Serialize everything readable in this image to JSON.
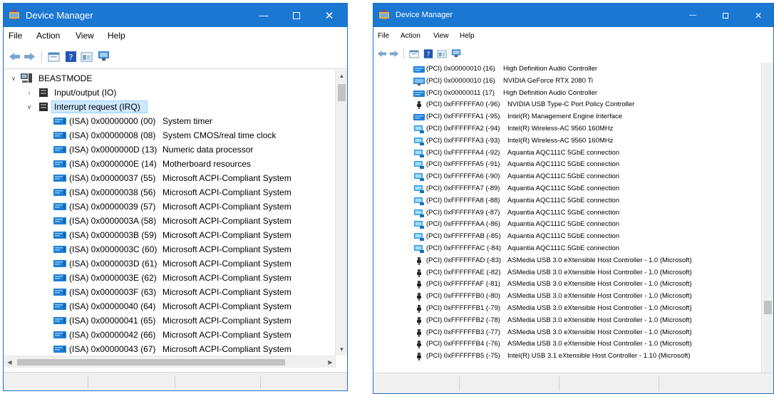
{
  "windows": [
    {
      "title": "Device Manager",
      "menu": [
        "File",
        "Action",
        "View",
        "Help"
      ],
      "tree": {
        "root": "BEASTMODE",
        "categories": [
          {
            "label": "Input/output (IO)",
            "expanded": false
          },
          {
            "label": "Interrupt request (IRQ)",
            "expanded": true
          }
        ],
        "irq_entries": [
          {
            "code": "(ISA) 0x00000000 (00)",
            "desc": "System timer"
          },
          {
            "code": "(ISA) 0x00000008 (08)",
            "desc": "System CMOS/real time clock"
          },
          {
            "code": "(ISA) 0x0000000D (13)",
            "desc": "Numeric data processor"
          },
          {
            "code": "(ISA) 0x0000000E (14)",
            "desc": "Motherboard resources"
          },
          {
            "code": "(ISA) 0x00000037 (55)",
            "desc": "Microsoft ACPI-Compliant System"
          },
          {
            "code": "(ISA) 0x00000038 (56)",
            "desc": "Microsoft ACPI-Compliant System"
          },
          {
            "code": "(ISA) 0x00000039 (57)",
            "desc": "Microsoft ACPI-Compliant System"
          },
          {
            "code": "(ISA) 0x0000003A (58)",
            "desc": "Microsoft ACPI-Compliant System"
          },
          {
            "code": "(ISA) 0x0000003B (59)",
            "desc": "Microsoft ACPI-Compliant System"
          },
          {
            "code": "(ISA) 0x0000003C (60)",
            "desc": "Microsoft ACPI-Compliant System"
          },
          {
            "code": "(ISA) 0x0000003D (61)",
            "desc": "Microsoft ACPI-Compliant System"
          },
          {
            "code": "(ISA) 0x0000003E (62)",
            "desc": "Microsoft ACPI-Compliant System"
          },
          {
            "code": "(ISA) 0x0000003F (63)",
            "desc": "Microsoft ACPI-Compliant System"
          },
          {
            "code": "(ISA) 0x00000040 (64)",
            "desc": "Microsoft ACPI-Compliant System"
          },
          {
            "code": "(ISA) 0x00000041 (65)",
            "desc": "Microsoft ACPI-Compliant System"
          },
          {
            "code": "(ISA) 0x00000042 (66)",
            "desc": "Microsoft ACPI-Compliant System"
          },
          {
            "code": "(ISA) 0x00000043 (67)",
            "desc": "Microsoft ACPI-Compliant System"
          }
        ]
      }
    },
    {
      "title": "Device Manager",
      "menu": [
        "File",
        "Action",
        "View",
        "Help"
      ],
      "pci_entries": [
        {
          "code": "(PCI) 0x00000010 (16)",
          "desc": "High Definition Audio Controller",
          "icon": "audio-device-icon"
        },
        {
          "code": "(PCI) 0x00000010 (16)",
          "desc": "NVIDIA GeForce RTX 2080 Ti",
          "icon": "display-adapter-icon"
        },
        {
          "code": "(PCI) 0x00000011 (17)",
          "desc": "High Definition Audio Controller",
          "icon": "audio-device-icon"
        },
        {
          "code": "(PCI) 0xFFFFFFA0 (-96)",
          "desc": "NVIDIA USB Type-C Port Policy Controller",
          "icon": "usb-plug-icon"
        },
        {
          "code": "(PCI) 0xFFFFFFA1 (-95)",
          "desc": "Intel(R) Management Engine Interface",
          "icon": "system-device-icon"
        },
        {
          "code": "(PCI) 0xFFFFFFA2 (-94)",
          "desc": "Intel(R) Wireless-AC 9560 160MHz",
          "icon": "network-adapter-icon"
        },
        {
          "code": "(PCI) 0xFFFFFFA3 (-93)",
          "desc": "Intel(R) Wireless-AC 9560 160MHz",
          "icon": "network-adapter-icon"
        },
        {
          "code": "(PCI) 0xFFFFFFA4 (-92)",
          "desc": "Aquantia AQC111C 5GbE connection",
          "icon": "network-adapter-icon"
        },
        {
          "code": "(PCI) 0xFFFFFFA5 (-91)",
          "desc": "Aquantia AQC111C 5GbE connection",
          "icon": "network-adapter-icon"
        },
        {
          "code": "(PCI) 0xFFFFFFA6 (-90)",
          "desc": "Aquantia AQC111C 5GbE connection",
          "icon": "network-adapter-icon"
        },
        {
          "code": "(PCI) 0xFFFFFFA7 (-89)",
          "desc": "Aquantia AQC111C 5GbE connection",
          "icon": "network-adapter-icon"
        },
        {
          "code": "(PCI) 0xFFFFFFA8 (-88)",
          "desc": "Aquantia AQC111C 5GbE connection",
          "icon": "network-adapter-icon"
        },
        {
          "code": "(PCI) 0xFFFFFFA9 (-87)",
          "desc": "Aquantia AQC111C 5GbE connection",
          "icon": "network-adapter-icon"
        },
        {
          "code": "(PCI) 0xFFFFFFAA (-86)",
          "desc": "Aquantia AQC111C 5GbE connection",
          "icon": "network-adapter-icon"
        },
        {
          "code": "(PCI) 0xFFFFFFAB (-85)",
          "desc": "Aquantia AQC111C 5GbE connection",
          "icon": "network-adapter-icon"
        },
        {
          "code": "(PCI) 0xFFFFFFAC (-84)",
          "desc": "Aquantia AQC111C 5GbE connection",
          "icon": "network-adapter-icon"
        },
        {
          "code": "(PCI) 0xFFFFFFAD (-83)",
          "desc": "ASMedia USB 3.0 eXtensible Host Controller - 1.0 (Microsoft)",
          "icon": "usb-plug-icon"
        },
        {
          "code": "(PCI) 0xFFFFFFAE (-82)",
          "desc": "ASMedia USB 3.0 eXtensible Host Controller - 1.0 (Microsoft)",
          "icon": "usb-plug-icon"
        },
        {
          "code": "(PCI) 0xFFFFFFAF (-81)",
          "desc": "ASMedia USB 3.0 eXtensible Host Controller - 1.0 (Microsoft)",
          "icon": "usb-plug-icon"
        },
        {
          "code": "(PCI) 0xFFFFFFB0 (-80)",
          "desc": "ASMedia USB 3.0 eXtensible Host Controller - 1.0 (Microsoft)",
          "icon": "usb-plug-icon"
        },
        {
          "code": "(PCI) 0xFFFFFFB1 (-79)",
          "desc": "ASMedia USB 3.0 eXtensible Host Controller - 1.0 (Microsoft)",
          "icon": "usb-plug-icon"
        },
        {
          "code": "(PCI) 0xFFFFFFB2 (-78)",
          "desc": "ASMedia USB 3.0 eXtensible Host Controller - 1.0 (Microsoft)",
          "icon": "usb-plug-icon"
        },
        {
          "code": "(PCI) 0xFFFFFFB3 (-77)",
          "desc": "ASMedia USB 3.0 eXtensible Host Controller - 1.0 (Microsoft)",
          "icon": "usb-plug-icon"
        },
        {
          "code": "(PCI) 0xFFFFFFB4 (-76)",
          "desc": "ASMedia USB 3.0 eXtensible Host Controller - 1.0 (Microsoft)",
          "icon": "usb-plug-icon"
        },
        {
          "code": "(PCI) 0xFFFFFFB5 (-75)",
          "desc": "Intel(R) USB 3.1 eXtensible Host Controller - 1.10 (Microsoft)",
          "icon": "usb-plug-icon"
        }
      ]
    }
  ],
  "colors": {
    "titlebar": "#1a78d2",
    "selection": "#cde8ff",
    "selection_border": "#99d1ff",
    "folder_icon": "#1e7fd6",
    "network_icon": "#2a9ee0"
  }
}
